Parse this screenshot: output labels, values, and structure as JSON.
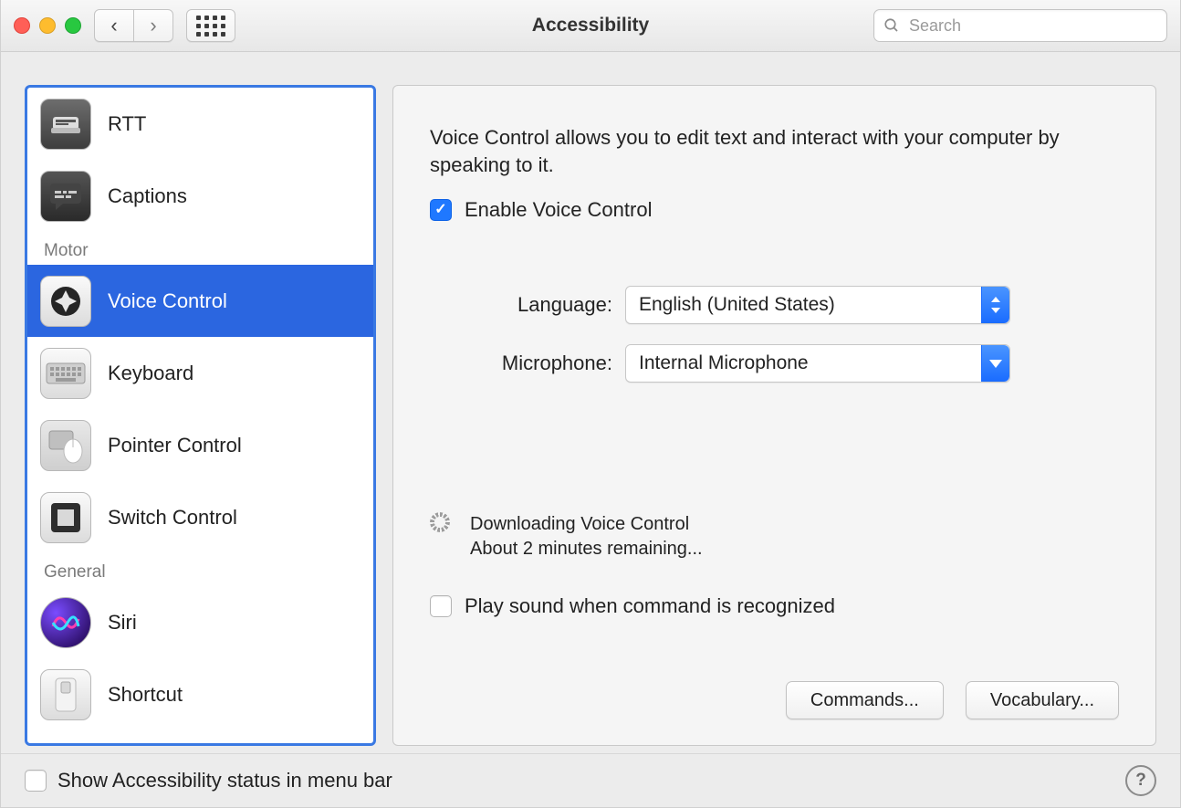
{
  "window": {
    "title": "Accessibility"
  },
  "search": {
    "placeholder": "Search",
    "value": ""
  },
  "sidebar": {
    "sections": [
      {
        "header": null,
        "items": [
          {
            "id": "rtt",
            "label": "RTT",
            "selected": false
          },
          {
            "id": "captions",
            "label": "Captions",
            "selected": false
          }
        ]
      },
      {
        "header": "Motor",
        "items": [
          {
            "id": "voice-control",
            "label": "Voice Control",
            "selected": true
          },
          {
            "id": "keyboard",
            "label": "Keyboard",
            "selected": false
          },
          {
            "id": "pointer-control",
            "label": "Pointer Control",
            "selected": false
          },
          {
            "id": "switch-control",
            "label": "Switch Control",
            "selected": false
          }
        ]
      },
      {
        "header": "General",
        "items": [
          {
            "id": "siri",
            "label": "Siri",
            "selected": false
          },
          {
            "id": "shortcut",
            "label": "Shortcut",
            "selected": false
          }
        ]
      }
    ]
  },
  "panel": {
    "description": "Voice Control allows you to edit text and interact with your computer by speaking to it.",
    "enable": {
      "label": "Enable Voice Control",
      "checked": true
    },
    "language": {
      "label": "Language:",
      "value": "English (United States)"
    },
    "microphone": {
      "label": "Microphone:",
      "value": "Internal Microphone"
    },
    "download": {
      "status": "Downloading Voice Control",
      "remaining": "About 2 minutes remaining..."
    },
    "playSound": {
      "label": "Play sound when command is recognized",
      "checked": false
    },
    "buttons": {
      "commands": "Commands...",
      "vocabulary": "Vocabulary..."
    }
  },
  "footer": {
    "statusCheckbox": {
      "label": "Show Accessibility status in menu bar",
      "checked": false
    },
    "help": "?"
  }
}
